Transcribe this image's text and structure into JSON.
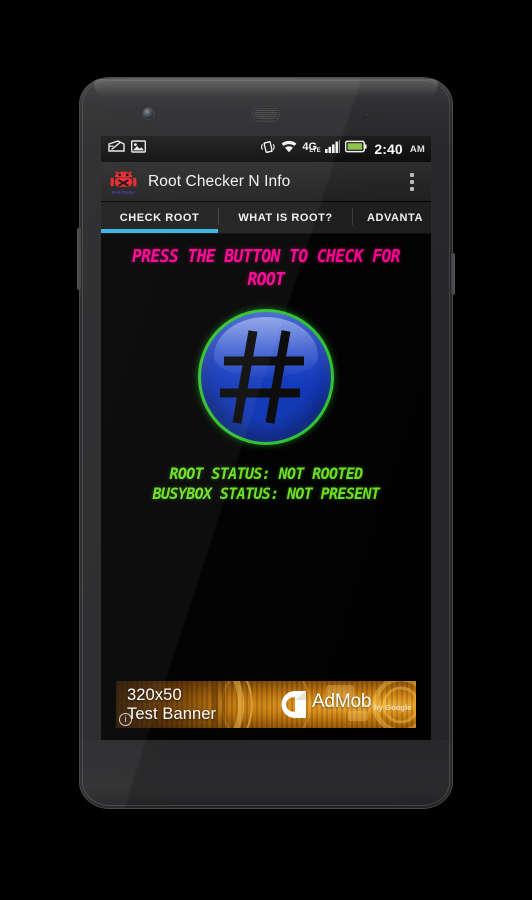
{
  "device": {
    "name": "android-phone-mockup",
    "camera_icon": "front-camera",
    "speaker_icon": "earpiece-speaker",
    "sensor_icon": "proximity-sensor"
  },
  "status_bar": {
    "left_icons": [
      {
        "name": "screenshot-icon",
        "label": "Screenshot"
      },
      {
        "name": "gallery-image-icon",
        "label": "Image saved"
      }
    ],
    "right_icons": [
      {
        "name": "vibrate-icon",
        "label": "Vibrate"
      },
      {
        "name": "wifi-icon",
        "label": "Wi-Fi"
      },
      {
        "name": "4g-lte-icon",
        "label": "4G LTE"
      },
      {
        "name": "signal-bars-icon",
        "label": "Signal"
      },
      {
        "name": "battery-icon",
        "label": "Battery"
      }
    ],
    "lte_main": "4G",
    "lte_sub": "LTE",
    "time": "2:40",
    "ampm": "AM",
    "battery_color": "#8bc34a"
  },
  "action_bar": {
    "app_icon": "root-skull-android-icon",
    "title": "Root Checker N Info",
    "overflow_label": "More options"
  },
  "tabs": {
    "items": [
      {
        "label": "CHECK ROOT",
        "active": true
      },
      {
        "label": "WHAT IS ROOT?",
        "active": false
      },
      {
        "label": "ADVANTA",
        "active": false
      }
    ],
    "indicator_color": "#33b5e5"
  },
  "main": {
    "heading": "PRESS THE BUTTON TO CHECK FOR ROOT",
    "heading_color": "#ff0090",
    "check_button": {
      "name": "root-check-button",
      "glyph": "#",
      "fill_color": "#1339bd",
      "ring_color": "#2fc22f"
    },
    "status_lines": [
      "ROOT STATUS: NOT ROOTED",
      "BUSYBOX STATUS: NOT PRESENT"
    ],
    "status_color": "#6be023"
  },
  "ad": {
    "line1": "320x50",
    "line2": "Test Banner",
    "brand": "AdMob",
    "byline": "by Google",
    "info_glyph": "i",
    "logo_name": "admob-logo"
  }
}
